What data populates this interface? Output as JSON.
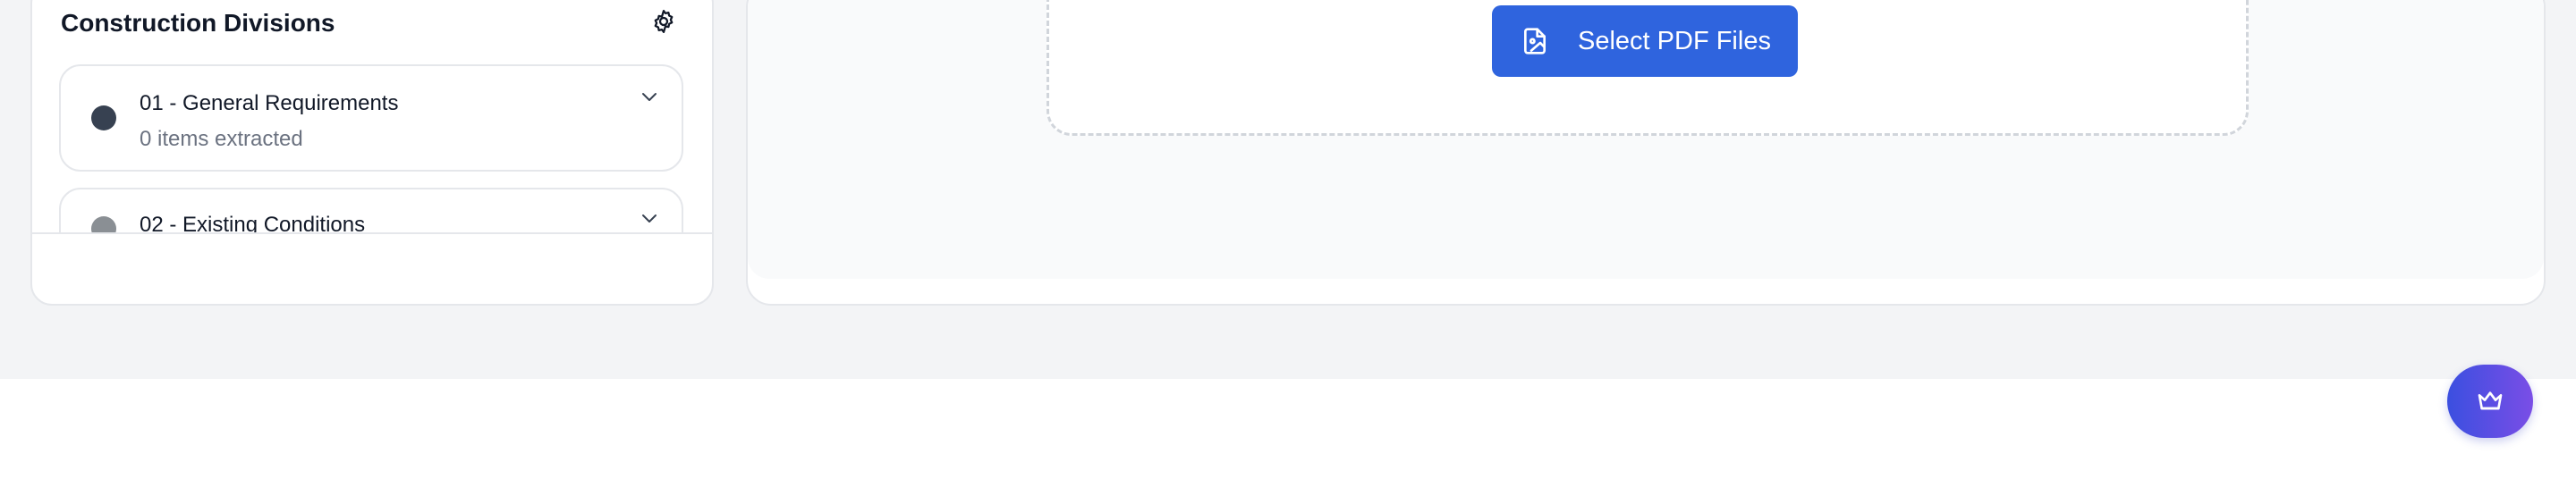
{
  "sidebar": {
    "title": "Construction Divisions",
    "settings_icon": "gear-icon",
    "divisions": [
      {
        "name": "01 - General Requirements",
        "subtitle": "0 items extracted",
        "dot_color": "#374151"
      },
      {
        "name": "02 - Existing Conditions",
        "subtitle": "",
        "dot_color": "#8a8f94"
      }
    ]
  },
  "upload": {
    "button_label": "Select PDF Files",
    "button_icon": "file-image-icon",
    "accent_color": "#2f64de"
  },
  "fab": {
    "icon": "crown-icon",
    "gradient": [
      "#3b4fe0",
      "#7a4ee6"
    ]
  }
}
